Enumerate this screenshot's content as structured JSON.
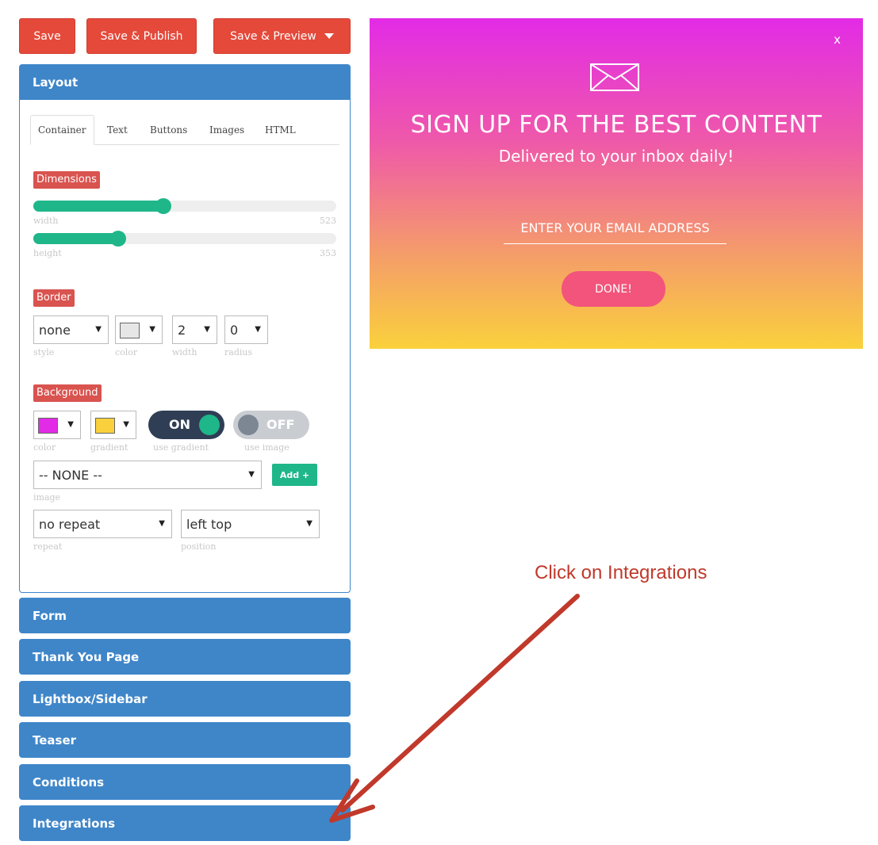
{
  "toolbar": {
    "save_label": "Save",
    "save_publish_label": "Save & Publish",
    "save_preview_label": "Save & Preview"
  },
  "layout_panel": {
    "title": "Layout",
    "tabs": [
      "Container",
      "Text",
      "Buttons",
      "Images",
      "HTML"
    ],
    "active_tab": "Container",
    "dimensions": {
      "label": "Dimensions",
      "width": {
        "label": "width",
        "value": "523",
        "fill_fraction": 0.43
      },
      "height": {
        "label": "height",
        "value": "353",
        "fill_fraction": 0.28
      }
    },
    "border": {
      "label": "Border",
      "style": {
        "value": "none",
        "label": "style"
      },
      "color": {
        "label": "color",
        "swatch": "#e6e6e6"
      },
      "width": {
        "value": "2",
        "label": "width"
      },
      "radius": {
        "value": "0",
        "label": "radius"
      }
    },
    "background": {
      "label": "Background",
      "color": {
        "label": "color",
        "swatch": "#e22be6"
      },
      "gradient": {
        "label": "gradient",
        "swatch": "#fad13c"
      },
      "use_gradient": {
        "state": "ON",
        "label": "use gradient"
      },
      "use_image": {
        "state": "OFF",
        "label": "use image"
      },
      "image": {
        "value": "-- NONE --",
        "label": "image"
      },
      "add_label": "Add +",
      "repeat": {
        "value": "no repeat",
        "label": "repeat"
      },
      "position": {
        "value": "left top",
        "label": "position"
      }
    }
  },
  "accordion": [
    "Form",
    "Thank You Page",
    "Lightbox/Sidebar",
    "Teaser",
    "Conditions",
    "Integrations"
  ],
  "popup": {
    "close": "x",
    "title": "SIGN UP FOR THE BEST CONTENT",
    "subtitle": "Delivered to your inbox daily!",
    "email_placeholder": "ENTER YOUR EMAIL ADDRESS",
    "button": "DONE!"
  },
  "annotation": {
    "text": "Click on Integrations",
    "color": "#c0392b"
  },
  "colors": {
    "accent_blue": "#3f86c9",
    "button_red": "#e5493a",
    "teal": "#1fb68a"
  }
}
